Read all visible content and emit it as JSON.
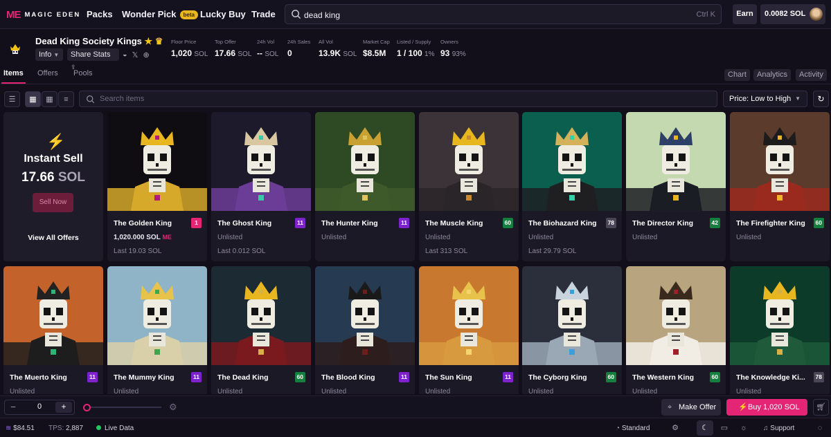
{
  "nav": {
    "logo_mark": "ME",
    "logo_text": "MAGIC EDEN",
    "links": [
      "Packs",
      "Wonder Pick",
      "Lucky Buy",
      "Trade"
    ],
    "beta_badge": "beta",
    "search_value": "dead king",
    "search_shortcut": "Ctrl K",
    "earn_label": "Earn",
    "balance": "0.0082 SOL"
  },
  "collection": {
    "name": "Dead King Society Kings",
    "info_label": "Info",
    "share_label": "Share Stats",
    "stats": [
      {
        "label": "Floor Price",
        "value": "1,020",
        "unit": "SOL"
      },
      {
        "label": "Top Offer",
        "value": "17.66",
        "unit": "SOL"
      },
      {
        "label": "24h Vol",
        "value": "--",
        "unit": "SOL"
      },
      {
        "label": "24h Sales",
        "value": "0",
        "unit": ""
      },
      {
        "label": "All Vol",
        "value": "13.9K",
        "unit": "SOL"
      },
      {
        "label": "Market Cap",
        "value": "$8.5M",
        "unit": ""
      },
      {
        "label": "Listed / Supply",
        "value": "1 / 100",
        "unit": "1%"
      },
      {
        "label": "Owners",
        "value": "93",
        "unit": "93%"
      }
    ]
  },
  "tabs": {
    "left": [
      "Items",
      "Offers",
      "Pools"
    ],
    "right": [
      "Chart",
      "Analytics",
      "Activity"
    ]
  },
  "toolbar": {
    "search_placeholder": "Search items",
    "sort_value": "Price: Low to High"
  },
  "instant_sell": {
    "title": "Instant Sell",
    "amount": "17.66",
    "unit": "SOL",
    "button": "Sell Now",
    "view_all": "View All Offers"
  },
  "colors": {
    "accent": "#e42575",
    "rank_pink": "#e42575",
    "rank_purple": "#7e22ce",
    "rank_green": "#15803d",
    "rank_gray": "#4a4557"
  },
  "items": [
    {
      "name": "The Golden King",
      "rank": "1",
      "rank_color": "pink",
      "price": "1,020.000 SOL",
      "last": "Last 19.03 SOL"
    },
    {
      "name": "The Ghost King",
      "rank": "11",
      "rank_color": "purple",
      "price": "Unlisted",
      "last": "Last 0.012 SOL"
    },
    {
      "name": "The Hunter King",
      "rank": "11",
      "rank_color": "purple",
      "price": "Unlisted",
      "last": ""
    },
    {
      "name": "The Muscle King",
      "rank": "60",
      "rank_color": "green",
      "price": "Unlisted",
      "last": "Last 313 SOL"
    },
    {
      "name": "The Biohazard King",
      "rank": "78",
      "rank_color": "gray",
      "price": "Unlisted",
      "last": "Last 29.79 SOL"
    },
    {
      "name": "The Director King",
      "rank": "42",
      "rank_color": "green",
      "price": "Unlisted",
      "last": ""
    },
    {
      "name": "The Firefighter King",
      "rank": "60",
      "rank_color": "green",
      "price": "Unlisted",
      "last": ""
    },
    {
      "name": "The Muerto King",
      "rank": "11",
      "rank_color": "purple",
      "price": "Unlisted",
      "last": ""
    },
    {
      "name": "The Mummy King",
      "rank": "11",
      "rank_color": "purple",
      "price": "Unlisted",
      "last": ""
    },
    {
      "name": "The Dead King",
      "rank": "60",
      "rank_color": "green",
      "price": "Unlisted",
      "last": ""
    },
    {
      "name": "The Blood King",
      "rank": "11",
      "rank_color": "purple",
      "price": "Unlisted",
      "last": ""
    },
    {
      "name": "The Sun King",
      "rank": "11",
      "rank_color": "purple",
      "price": "Unlisted",
      "last": ""
    },
    {
      "name": "The Cyborg King",
      "rank": "60",
      "rank_color": "green",
      "price": "Unlisted",
      "last": ""
    },
    {
      "name": "The Western King",
      "rank": "60",
      "rank_color": "green",
      "price": "Unlisted",
      "last": ""
    },
    {
      "name": "The Knowledge Ki...",
      "rank": "78",
      "rank_color": "gray",
      "price": "Unlisted",
      "last": ""
    }
  ],
  "bottom_bar": {
    "quantity": "0",
    "minus": "−",
    "plus": "+",
    "make_offer": "Make Offer",
    "buy": "Buy 1,020 SOL"
  },
  "footer": {
    "sol_price": "$84.51",
    "tps_label": "TPS:",
    "tps_value": "2,887",
    "live_data": "Live Data",
    "standard": "Standard",
    "support": "Support"
  }
}
